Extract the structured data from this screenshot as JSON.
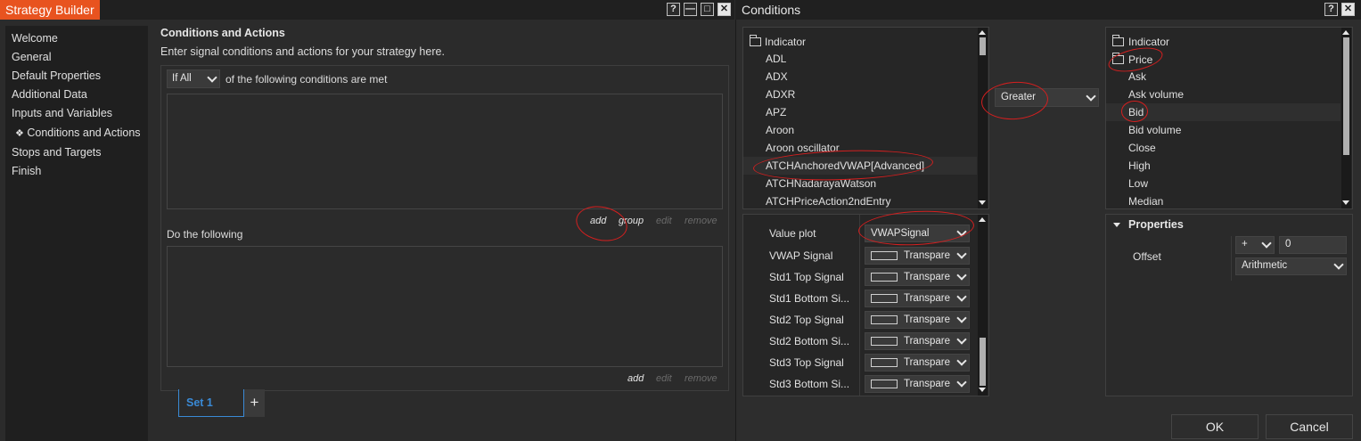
{
  "left_window": {
    "title": "Strategy Builder",
    "title_buttons": [
      "?",
      "—",
      "□",
      "✕"
    ],
    "sidebar": [
      {
        "label": "Welcome",
        "active": false
      },
      {
        "label": "General",
        "active": false
      },
      {
        "label": "Default Properties",
        "active": false
      },
      {
        "label": "Additional Data",
        "active": false
      },
      {
        "label": "Inputs and Variables",
        "active": false
      },
      {
        "label": "Conditions and Actions",
        "active": true
      },
      {
        "label": "Stops and Targets",
        "active": false
      },
      {
        "label": "Finish",
        "active": false
      }
    ],
    "heading": "Conditions and Actions",
    "subheading": "Enter signal conditions and actions for your strategy here.",
    "condition_mode": "If All",
    "condition_suffix": "of the following conditions are met",
    "cond_actions": {
      "add": "add",
      "group": "group",
      "edit": "edit",
      "remove": "remove"
    },
    "do_label": "Do the following",
    "do_actions": {
      "add": "add",
      "edit": "edit",
      "remove": "remove"
    },
    "set_tab": "Set 1",
    "add_set": "+"
  },
  "right_window": {
    "title": "Conditions",
    "title_buttons": [
      "?",
      "✕"
    ],
    "left_list": {
      "root": "Indicator",
      "items": [
        "ADL",
        "ADX",
        "ADXR",
        "APZ",
        "Aroon",
        "Aroon oscillator",
        "ATCHAnchoredVWAP[Advanced]",
        "ATCHNadarayaWatson",
        "ATCHPriceAction2ndEntry"
      ],
      "selected": "ATCHAnchoredVWAP[Advanced]"
    },
    "operator": "Greater",
    "right_list": {
      "root1": "Indicator",
      "root2": "Price",
      "items": [
        "Ask",
        "Ask volume",
        "Bid",
        "Bid volume",
        "Close",
        "High",
        "Low",
        "Median"
      ],
      "selected": "Bid"
    },
    "left_props": [
      {
        "label": "Value plot",
        "value": "VWAPSignal",
        "swatch": false
      },
      {
        "label": "VWAP Signal",
        "value": "Transpare",
        "swatch": true
      },
      {
        "label": "Std1 Top Signal",
        "value": "Transpare",
        "swatch": true
      },
      {
        "label": "Std1 Bottom Si...",
        "value": "Transpare",
        "swatch": true
      },
      {
        "label": "Std2 Top Signal",
        "value": "Transpare",
        "swatch": true
      },
      {
        "label": "Std2 Bottom Si...",
        "value": "Transpare",
        "swatch": true
      },
      {
        "label": "Std3 Top Signal",
        "value": "Transpare",
        "swatch": true
      },
      {
        "label": "Std3 Bottom Si...",
        "value": "Transpare",
        "swatch": true
      }
    ],
    "properties": {
      "header": "Properties",
      "offset_label": "Offset",
      "offset_sign": "+",
      "offset_value": "0",
      "offset_type": "Arithmetic"
    },
    "ok": "OK",
    "cancel": "Cancel"
  }
}
